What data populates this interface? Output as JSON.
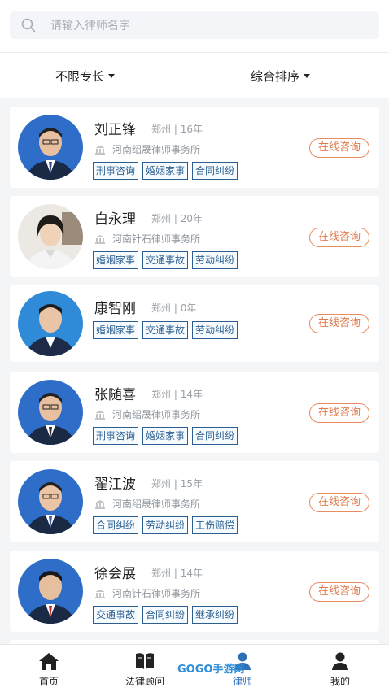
{
  "search": {
    "placeholder": "请输入律师名字"
  },
  "filters": {
    "specialty": "不限专长",
    "sort": "综合排序"
  },
  "lawyers": [
    {
      "name": "刘正锋",
      "city": "郑州",
      "years": "16年",
      "firm": "河南绍晟律师事务所",
      "tags": [
        "刑事咨询",
        "婚姻家事",
        "合同纠纷"
      ],
      "action": "在线咨询"
    },
    {
      "name": "白永理",
      "city": "郑州",
      "years": "20年",
      "firm": "河南针石律师事务所",
      "tags": [
        "婚姻家事",
        "交通事故",
        "劳动纠纷"
      ],
      "action": "在线咨询"
    },
    {
      "name": "康智刚",
      "city": "郑州",
      "years": "0年",
      "firm": "",
      "tags": [
        "婚姻家事",
        "交通事故",
        "劳动纠纷"
      ],
      "action": "在线咨询"
    },
    {
      "name": "张随喜",
      "city": "郑州",
      "years": "14年",
      "firm": "河南绍晟律师事务所",
      "tags": [
        "刑事咨询",
        "婚姻家事",
        "合同纠纷"
      ],
      "action": "在线咨询"
    },
    {
      "name": "翟江波",
      "city": "郑州",
      "years": "15年",
      "firm": "河南绍晟律师事务所",
      "tags": [
        "合同纠纷",
        "劳动纠纷",
        "工伤赔偿"
      ],
      "action": "在线咨询"
    },
    {
      "name": "徐会展",
      "city": "郑州",
      "years": "14年",
      "firm": "河南针石律师事务所",
      "tags": [
        "交通事故",
        "合同纠纷",
        "继承纠纷"
      ],
      "action": "在线咨询"
    }
  ],
  "tabbar": [
    {
      "label": "首页",
      "icon": "home-icon"
    },
    {
      "label": "法律顾问",
      "icon": "book-icon"
    },
    {
      "label": "律师",
      "icon": "lawyer-icon"
    },
    {
      "label": "我的",
      "icon": "user-icon"
    }
  ],
  "watermark": {
    "text": "GOGO手游网"
  },
  "colors": {
    "tag": "#2c5e8f",
    "consult": "#e07a4c",
    "active_tab": "#2f6fb5"
  }
}
